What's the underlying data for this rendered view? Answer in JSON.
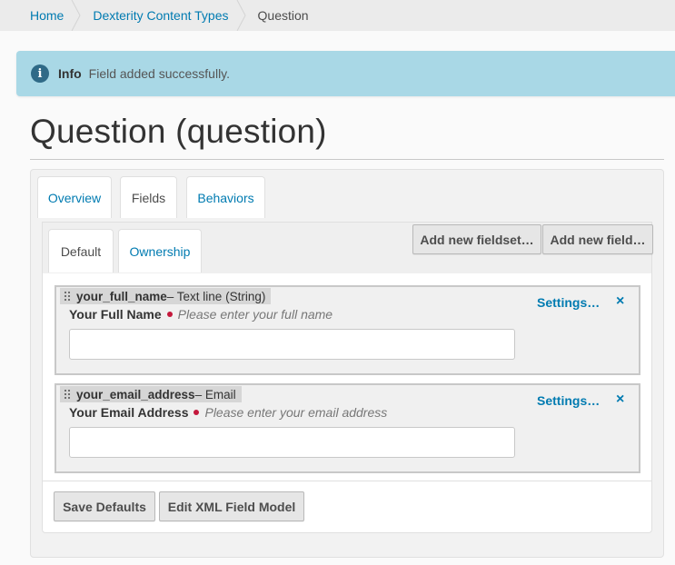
{
  "breadcrumb": {
    "items": [
      "Home",
      "Dexterity Content Types",
      "Question"
    ]
  },
  "alert": {
    "icon": "info-icon",
    "icon_glyph": "i",
    "label": "Info",
    "message": "Field added successfully."
  },
  "page": {
    "title": "Question (question)"
  },
  "tabs": {
    "overview": "Overview",
    "fields": "Fields",
    "behaviors": "Behaviors",
    "active": "Fields"
  },
  "fieldsets": {
    "default": "Default",
    "ownership": "Ownership",
    "active": "Default"
  },
  "toolbar": {
    "add_fieldset": "Add new fieldset…",
    "add_field": "Add new field…"
  },
  "fields": [
    {
      "name": "your_full_name",
      "type": " – Text line (String)",
      "label": "Your Full Name",
      "required": true,
      "help": "Please enter your full name",
      "value": "",
      "settings": "Settings…",
      "remove": "×"
    },
    {
      "name": "your_email_address",
      "type": " – Email",
      "label": "Your Email Address",
      "required": true,
      "help": "Please enter your email address",
      "value": "",
      "settings": "Settings…",
      "remove": "×"
    }
  ],
  "footer": {
    "save_defaults": "Save Defaults",
    "edit_xml": "Edit XML Field Model"
  },
  "colors": {
    "link": "#007bb1",
    "alert_bg": "#a9d8e6",
    "required": "#c4183c"
  }
}
